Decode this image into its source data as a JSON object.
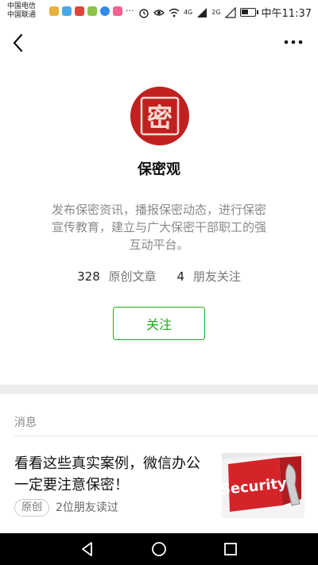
{
  "status_bar": {
    "carrier_1": "中国电信",
    "carrier_2": "中国联通",
    "network_1": "4G",
    "network_2": "2G",
    "battery_level": 0.55,
    "time": "中午11:37"
  },
  "nav": {
    "back_icon": "chevron-left-icon",
    "more_icon": "more-dots-icon"
  },
  "profile": {
    "name": "保密观",
    "avatar_glyph": "密",
    "description": "发布保密资讯，播报保密动态，进行保密宣传教育，建立与广大保密干部职工的强互动平台。",
    "articles_count": "328",
    "articles_label": "原创文章",
    "friends_count": "4",
    "friends_label": "朋友关注",
    "follow_label": "关注"
  },
  "messages": {
    "section_label": "消息",
    "articles": [
      {
        "title": "看看这些真实案例，微信办公一定要注意保密！",
        "tag": "原创",
        "readers": "2位朋友读过",
        "thumb_text": "Security"
      }
    ]
  },
  "colors": {
    "accent_green": "#1aad19",
    "seal_red": "#c0201f",
    "thumb_red": "#d4242a"
  }
}
